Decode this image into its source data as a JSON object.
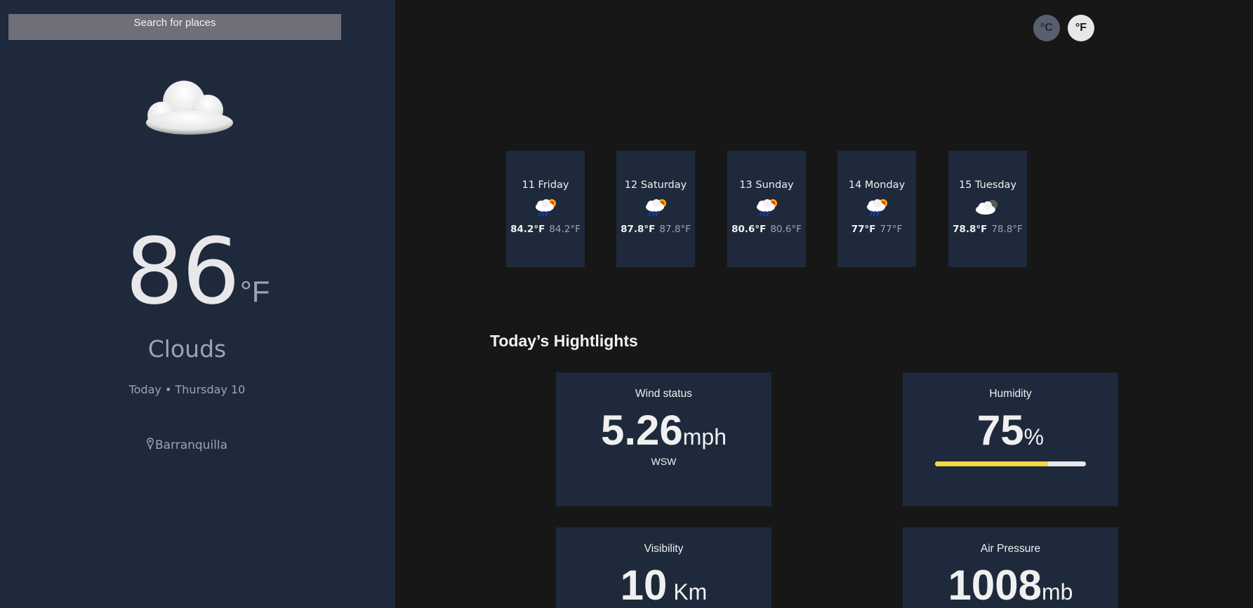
{
  "search": {
    "placeholder": "Search for places"
  },
  "current": {
    "icon": "cloud-icon",
    "temperature": "86",
    "unit": "°F",
    "condition": "Clouds",
    "date": "Today • Thursday 10",
    "location": "Barranquilla"
  },
  "units": {
    "celsius_label": "°C",
    "fahrenheit_label": "°F",
    "selected": "°F"
  },
  "forecast": [
    {
      "day": "11 Friday",
      "icon": "rain-sun-icon",
      "max": "84.2°F",
      "min": "84.2°F"
    },
    {
      "day": "12 Saturday",
      "icon": "rain-sun-icon",
      "max": "87.8°F",
      "min": "87.8°F"
    },
    {
      "day": "13 Sunday",
      "icon": "rain-sun-icon",
      "max": "80.6°F",
      "min": "80.6°F"
    },
    {
      "day": "14 Monday",
      "icon": "rain-sun-icon",
      "max": "77°F",
      "min": "77°F"
    },
    {
      "day": "15 Tuesday",
      "icon": "cloud-moon-icon",
      "max": "78.8°F",
      "min": "78.8°F"
    }
  ],
  "highlights": {
    "title": "Today’s Hightlights",
    "wind": {
      "label": "Wind status",
      "value": "5.26",
      "unit": "mph",
      "direction": "WSW"
    },
    "humidity": {
      "label": "Humidity",
      "value": "75",
      "unit": "%",
      "percent": 75,
      "bar_color": "#f5d73f"
    },
    "visibility": {
      "label": "Visibility",
      "value": "10",
      "unit": " Km"
    },
    "pressure": {
      "label": "Air Pressure",
      "value": "1008",
      "unit": "mb"
    }
  },
  "colors": {
    "sidebar": "#1e293b",
    "background": "#171717",
    "card": "#1e293b",
    "accent": "#f5d73f"
  }
}
